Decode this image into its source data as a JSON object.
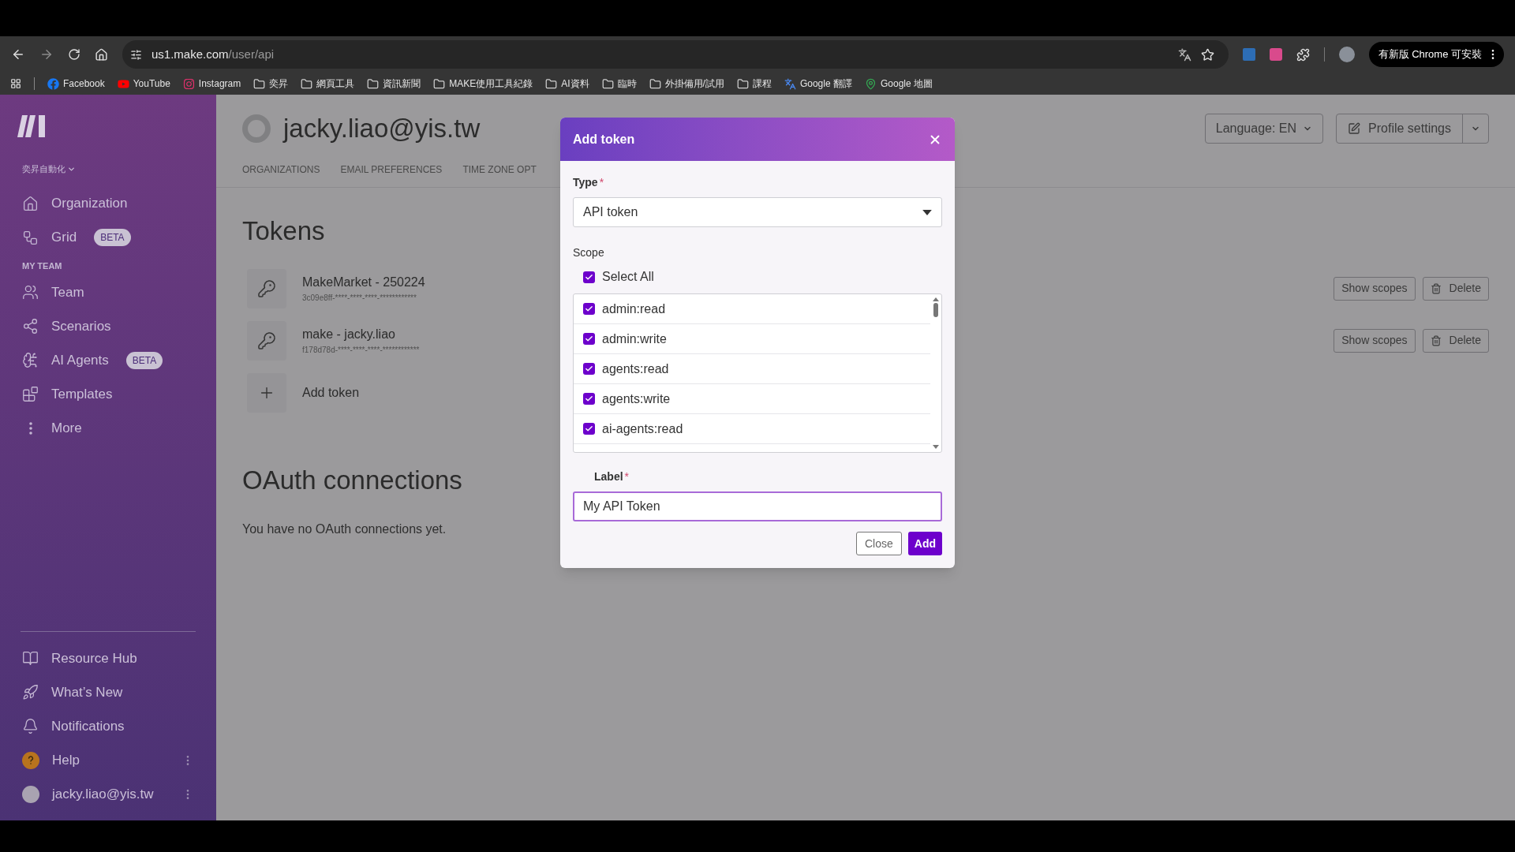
{
  "browser": {
    "url_host": "us1.make.com",
    "url_path": "/user/api",
    "update_button": "有新版 Chrome 可安裝",
    "bookmarks": [
      {
        "label": "Facebook",
        "kind": "facebook"
      },
      {
        "label": "YouTube",
        "kind": "youtube"
      },
      {
        "label": "Instagram",
        "kind": "instagram"
      },
      {
        "label": "奕昇",
        "kind": "folder"
      },
      {
        "label": "網頁工具",
        "kind": "folder"
      },
      {
        "label": "資訊新聞",
        "kind": "folder"
      },
      {
        "label": "MAKE使用工具紀錄",
        "kind": "folder"
      },
      {
        "label": "AI資料",
        "kind": "folder"
      },
      {
        "label": "臨時",
        "kind": "folder"
      },
      {
        "label": "外掛備用/試用",
        "kind": "folder"
      },
      {
        "label": "課程",
        "kind": "folder"
      },
      {
        "label": "Google 翻譯",
        "kind": "translate"
      },
      {
        "label": "Google 地圖",
        "kind": "maps"
      }
    ]
  },
  "sidebar": {
    "org_switcher": "奕昇自動化",
    "org_items": [
      {
        "label": "Organization"
      },
      {
        "label": "Grid",
        "badge": "BETA"
      }
    ],
    "section_label": "MY TEAM",
    "team_items": [
      {
        "label": "Team"
      },
      {
        "label": "Scenarios"
      },
      {
        "label": "AI Agents",
        "badge": "BETA"
      },
      {
        "label": "Templates"
      },
      {
        "label": "More"
      }
    ],
    "bottom_items": [
      {
        "label": "Resource Hub",
        "kind": "link"
      },
      {
        "label": "What’s New",
        "kind": "link"
      },
      {
        "label": "Notifications",
        "kind": "link"
      },
      {
        "label": "Help",
        "kind": "help"
      },
      {
        "label": "jacky.liao@yis.tw",
        "kind": "user"
      }
    ]
  },
  "header": {
    "title": "jacky.liao@yis.tw",
    "tabs": [
      "ORGANIZATIONS",
      "EMAIL PREFERENCES",
      "TIME ZONE OPT"
    ],
    "language_button": "Language: EN",
    "profile_button": "Profile settings"
  },
  "tokens": {
    "title": "Tokens",
    "items": [
      {
        "name": "MakeMarket - 250224",
        "masked": "3c09e8ff-****-****-****-************",
        "show_scopes": "Show scopes",
        "delete": "Delete"
      },
      {
        "name": "make - jacky.liao",
        "masked": "f178d78d-****-****-****-************",
        "show_scopes": "Show scopes",
        "delete": "Delete"
      }
    ],
    "add_label": "Add token"
  },
  "oauth": {
    "title": "OAuth connections",
    "empty_text": "You have no OAuth connections yet."
  },
  "modal": {
    "title": "Add token",
    "required_mark": "*",
    "type_label": "Type",
    "type_value": "API token",
    "scope_label": "Scope",
    "select_all": {
      "label": "Select All",
      "checked": true
    },
    "scopes": [
      {
        "label": "admin:read",
        "checked": true
      },
      {
        "label": "admin:write",
        "checked": true
      },
      {
        "label": "agents:read",
        "checked": true
      },
      {
        "label": "agents:write",
        "checked": true
      },
      {
        "label": "ai-agents:read",
        "checked": true
      }
    ],
    "label_label": "Label",
    "label_value": "My API Token",
    "close_button": "Close",
    "add_button": "Add"
  }
}
